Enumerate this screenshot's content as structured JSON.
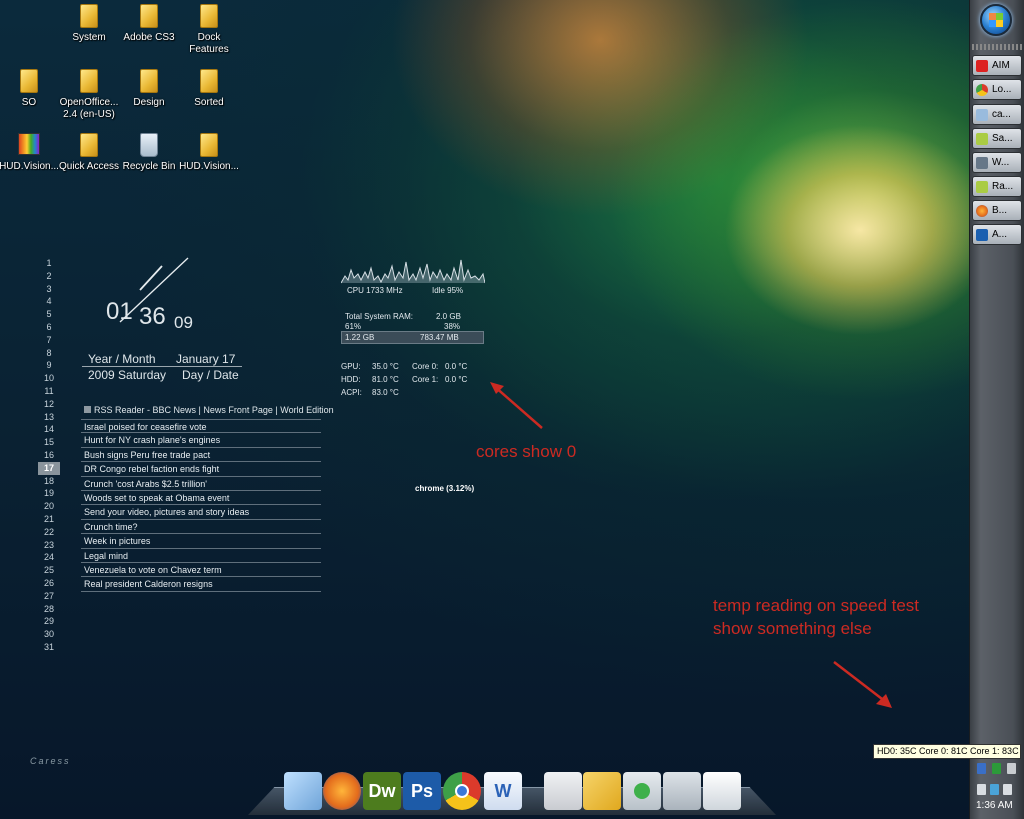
{
  "desktop_icons": [
    {
      "label": "System"
    },
    {
      "label": "Adobe CS3"
    },
    {
      "label": "Dock Features"
    },
    {
      "label": "SO"
    },
    {
      "label": "OpenOffice... 2.4 (en-US)"
    },
    {
      "label": "Design"
    },
    {
      "label": "Sorted"
    },
    {
      "label": "HUD.Vision..."
    },
    {
      "label": "Quick Access"
    },
    {
      "label": "Recycle Bin"
    },
    {
      "label": "HUD.Vision..."
    }
  ],
  "calendar": {
    "days": [
      "1",
      "2",
      "3",
      "4",
      "5",
      "6",
      "7",
      "8",
      "9",
      "10",
      "11",
      "12",
      "13",
      "14",
      "15",
      "16",
      "17",
      "18",
      "19",
      "20",
      "21",
      "22",
      "23",
      "24",
      "25",
      "26",
      "27",
      "28",
      "29",
      "30",
      "31"
    ],
    "today": "17"
  },
  "clock": {
    "hours": "01",
    "minutes": "36",
    "seconds": "09",
    "year_month_label": "Year / Month",
    "month_day": "January 17",
    "year_weekday": "2009 Saturday",
    "day_date_label": "Day / Date"
  },
  "rss": {
    "header": "RSS Reader - BBC News | News Front Page | World Edition",
    "items": [
      "Israel poised for ceasefire vote",
      "Hunt for NY crash plane's engines",
      "Bush signs Peru free trade pact",
      "DR Congo rebel faction ends fight",
      "Crunch 'cost Arabs $2.5 trillion'",
      "Woods set to speak at Obama event",
      "Send your video, pictures and story ideas",
      "Crunch time?",
      "Week in pictures",
      "Legal mind",
      "Venezuela to vote on Chavez term",
      "Real president Calderon resigns"
    ]
  },
  "monitor": {
    "cpu": "CPU 1733 MHz",
    "idle": "Idle 95%",
    "ram_label": "Total System RAM:",
    "ram_total": "2.0 GB",
    "ram_used_pct": "61%",
    "ram_free_pct": "38%",
    "ram_used": "1.22 GB",
    "ram_free": "783.47 MB",
    "gpu_label": "GPU:",
    "gpu_temp": "35.0 °C",
    "hdd_label": "HDD:",
    "hdd_temp": "81.0 °C",
    "acpi_label": "ACPI:",
    "acpi_temp": "83.0 °C",
    "core0_label": "Core 0:",
    "core0_temp": "0.0 °C",
    "core1_label": "Core 1:",
    "core1_temp": "0.0 °C",
    "top_process": "chrome (3.12%)"
  },
  "annotations": {
    "cores_note": "cores show 0",
    "temp_note_line1": "temp reading on speed test",
    "temp_note_line2": "show something else",
    "color": "#cc2a22"
  },
  "taskbar": {
    "buttons": [
      {
        "label": "AIM",
        "icon": "aim-icon",
        "color": "#d22"
      },
      {
        "label": "Lo...",
        "icon": "chrome-icon",
        "color": "#3a8"
      },
      {
        "label": "ca...",
        "icon": "document-icon",
        "color": "#9bd"
      },
      {
        "label": "Sa...",
        "icon": "notepad-icon",
        "color": "#ac4"
      },
      {
        "label": "W...",
        "icon": "monitor-icon",
        "color": "#678"
      },
      {
        "label": "Ra...",
        "icon": "notepad-icon",
        "color": "#ac4"
      },
      {
        "label": "B...",
        "icon": "firefox-icon",
        "color": "#e72"
      },
      {
        "label": "A...",
        "icon": "photoshop-icon",
        "color": "#1a5fb0"
      }
    ],
    "tooltip": "HD0: 35C Core 0: 81C Core 1: 83C",
    "clock": "1:36 AM"
  },
  "dock": {
    "items": [
      {
        "name": "text-editor-icon",
        "label": "",
        "color": "#6fa4d8"
      },
      {
        "name": "firefox-icon",
        "label": "",
        "color": "#e36b1c"
      },
      {
        "name": "dreamweaver-icon",
        "label": "Dw",
        "color": "#4d7c1e"
      },
      {
        "name": "photoshop-icon",
        "label": "Ps",
        "color": "#1d5ba8"
      },
      {
        "name": "chrome-icon",
        "label": "",
        "color": "#3ea048"
      },
      {
        "name": "word-icon",
        "label": "W",
        "color": "#2b62b7"
      },
      {
        "name": "presentation-icon",
        "label": "",
        "color": "#c9ccd1"
      },
      {
        "name": "tools-icon",
        "label": "",
        "color": "#e0a81e"
      },
      {
        "name": "download-folder-icon",
        "label": "",
        "color": "#b8c1c9"
      },
      {
        "name": "folder-icon",
        "label": "",
        "color": "#aab3bc"
      },
      {
        "name": "documents-icon",
        "label": "",
        "color": "#cfd6dc"
      }
    ]
  },
  "watermark": "Caress"
}
